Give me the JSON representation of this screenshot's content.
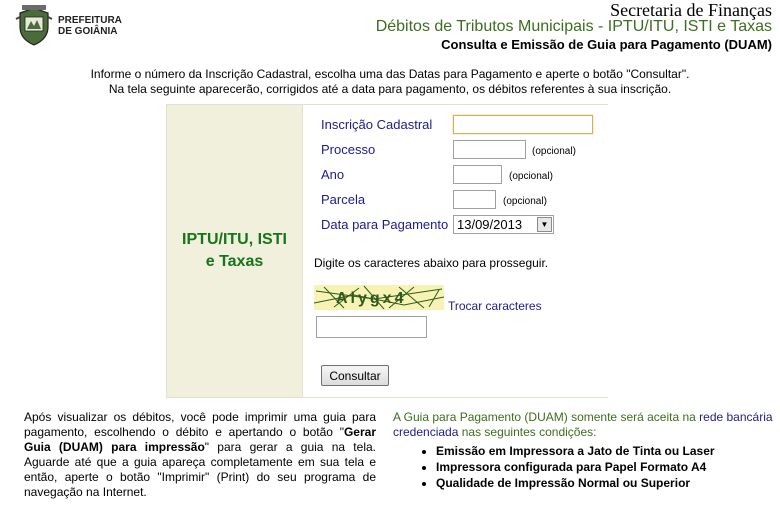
{
  "header": {
    "logo_line1": "PREFEITURA",
    "logo_line2": "DE GOIÂNIA",
    "title1": "Secretaria de Finanças",
    "title2": "Débitos de Tributos Municipais - IPTU/ITU, ISTI e Taxas",
    "title3": "Consulta e Emissão de Guia para Pagamento (DUAM)"
  },
  "instructions": {
    "line1": "Informe o número da Inscrição Cadastral, escolha uma das Datas para Pagamento e aperte o botão \"Consultar\".",
    "line2": "Na tela seguinte aparecerão, corrigidos até a data para pagamento, os débitos referentes à sua inscrição."
  },
  "panel": {
    "title_line1": "IPTU/ITU, ISTI",
    "title_line2": "e Taxas"
  },
  "form": {
    "inscricao_label": "Inscrição Cadastral",
    "inscricao_value": "",
    "processo_label": "Processo",
    "processo_value": "",
    "processo_hint": "(opcional)",
    "ano_label": "Ano",
    "ano_value": "",
    "ano_hint": "(opcional)",
    "parcela_label": "Parcela",
    "parcela_value": "",
    "parcela_hint": "(opcional)",
    "data_label": "Data para Pagamento",
    "data_value": "13/09/2013",
    "captcha_prompt": "Digite os caracteres abaixo para prosseguir.",
    "captcha_text": "Alygx4",
    "captcha_link": "Trocar caracteres",
    "captcha_value": "",
    "submit_label": "Consultar"
  },
  "bottom_left": {
    "part1": "Após visualizar os débitos, você pode imprimir uma guia para pagamento, escolhendo o débito e apertando o botão \"",
    "bold": "Gerar Guia (DUAM) para impressão",
    "part2": "\" para gerar a guia na tela. Aguarde até que a guia apareça completamente em sua tela e então, aperte o botão \"Imprimir\" (Print) do seu programa de navegação na Internet."
  },
  "bottom_right": {
    "part1": "A Guia para Pagamento (DUAM) somente será aceita na ",
    "link": "rede bancária credenciada",
    "part2": " nas seguintes condições:",
    "conditions": [
      "Emissão em Impressora a Jato de Tinta ou Laser",
      "Impressora configurada para Papel Formato A4",
      "Qualidade de Impressão Normal ou Superior"
    ]
  },
  "colors": {
    "green_title": "#3c6e1e",
    "panel_title": "#16741a",
    "label_blue": "#1c1c8c",
    "panel_bg": "#f0f0dc",
    "captcha_bg": "#f6f3b4"
  }
}
